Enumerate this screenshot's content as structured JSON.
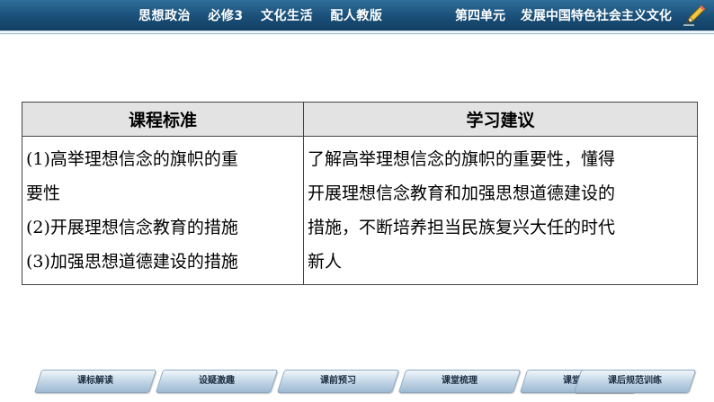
{
  "header": {
    "book_parts": [
      "思想政治",
      "必修3",
      "文化生活",
      "配人教版"
    ],
    "unit_label": "第四单元",
    "unit_title": "发展中国特色社会主义文化",
    "pen_icon": "pencil-icon"
  },
  "table": {
    "headers": [
      "课程标准",
      "学习建议"
    ],
    "left_lines": [
      "(1)高举理想信念的旗帜的重",
      "要性",
      "(2)开展理想信念教育的措施",
      "(3)加强思想道德建设的措施"
    ],
    "right_lines": [
      "了解高举理想信念的旗帜的重要性，懂得",
      "开展理想信念教育和加强思想道德建设的",
      "措施，不断培养担当民族复兴大任的时代",
      "新人"
    ]
  },
  "nav": {
    "buttons": [
      "课标解读",
      "设疑激趣",
      "课前预习",
      "课堂梳理",
      "课堂训练",
      "课后规范训练"
    ]
  },
  "colors": {
    "banner": "#1a4f78",
    "header_bg": "#e3e3e3",
    "nav_btn": "#c7d9e8"
  }
}
